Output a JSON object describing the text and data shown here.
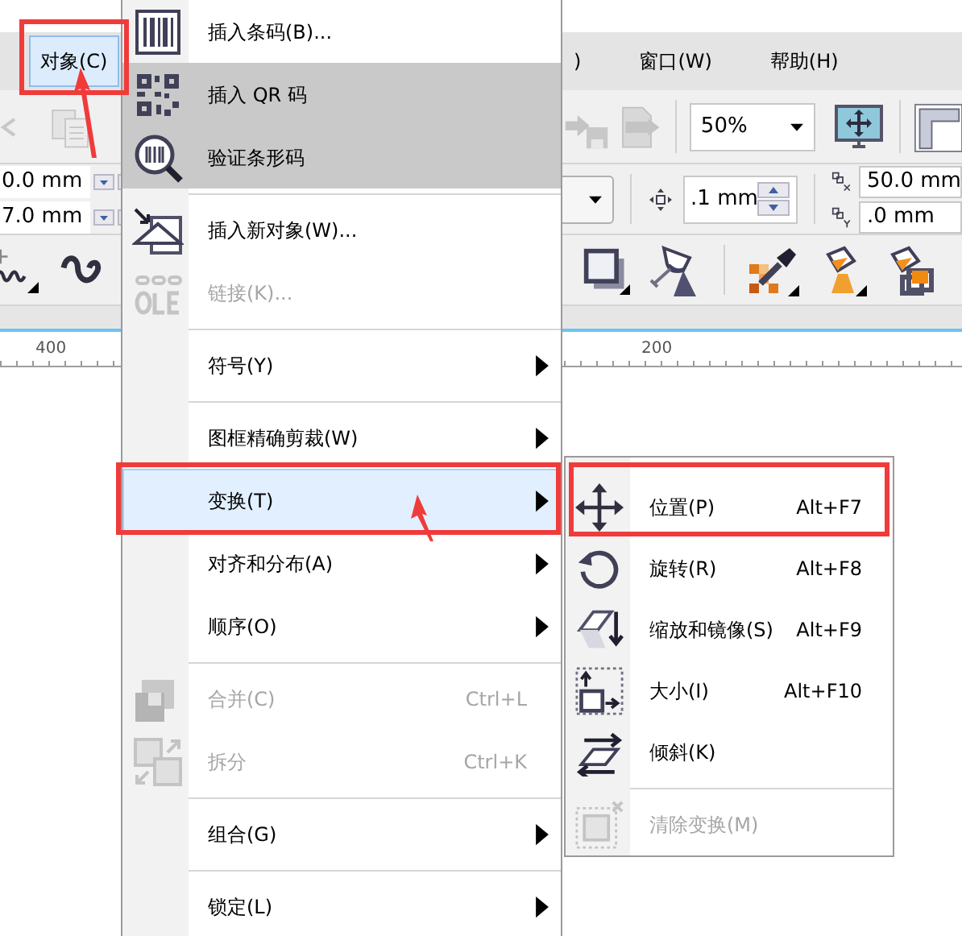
{
  "menubar": [
    {
      "label": "对象(C)",
      "selected": true,
      "framed": true,
      "arrow": true
    },
    {
      "label": ")",
      "selected": false
    },
    {
      "label": "窗口(W)",
      "selected": false
    },
    {
      "label": "帮助(H)",
      "selected": false
    }
  ],
  "toolbar": {
    "zoom": "50%"
  },
  "property_bar": {
    "size_fields": [
      "0.0 mm",
      "7.0 mm"
    ],
    "nudge": ".1 mm",
    "duplicate_x": "50.0 mm",
    "duplicate_y": ".0 mm"
  },
  "ruler": {
    "labels": [
      "400",
      "200"
    ]
  },
  "menu": {
    "items": [
      {
        "kind": "item",
        "label": "插入条码(B)...",
        "shaded": false,
        "disabled": false,
        "selected": false,
        "submenu": false
      },
      {
        "kind": "item",
        "label": "插入 QR 码",
        "shaded": true,
        "disabled": false,
        "selected": false,
        "submenu": false
      },
      {
        "kind": "item",
        "label": "验证条形码",
        "shaded": true,
        "disabled": false,
        "selected": false,
        "submenu": false
      },
      {
        "kind": "separator"
      },
      {
        "kind": "item",
        "label": "插入新对象(W)...",
        "shaded": false,
        "disabled": false,
        "selected": false,
        "submenu": false
      },
      {
        "kind": "item",
        "label": "链接(K)...",
        "shaded": false,
        "disabled": true,
        "selected": false,
        "submenu": false
      },
      {
        "kind": "separator"
      },
      {
        "kind": "item",
        "label": "符号(Y)",
        "shaded": false,
        "disabled": false,
        "selected": false,
        "submenu": true
      },
      {
        "kind": "separator"
      },
      {
        "kind": "item",
        "label": "图框精确剪裁(W)",
        "shaded": false,
        "disabled": false,
        "selected": false,
        "submenu": true
      },
      {
        "kind": "item",
        "label": "变换(T)",
        "shaded": false,
        "disabled": false,
        "selected": true,
        "submenu": true,
        "framed": true,
        "arrow": true
      },
      {
        "kind": "item",
        "label": "对齐和分布(A)",
        "shaded": false,
        "disabled": false,
        "selected": false,
        "submenu": true
      },
      {
        "kind": "item",
        "label": "顺序(O)",
        "shaded": false,
        "disabled": false,
        "selected": false,
        "submenu": true
      },
      {
        "kind": "separator"
      },
      {
        "kind": "item",
        "label": "合并(C)",
        "shortcut": "Ctrl+L",
        "shaded": false,
        "disabled": true,
        "selected": false,
        "submenu": false
      },
      {
        "kind": "item",
        "label": "拆分",
        "shortcut": "Ctrl+K",
        "shaded": false,
        "disabled": true,
        "selected": false,
        "submenu": false
      },
      {
        "kind": "separator"
      },
      {
        "kind": "item",
        "label": "组合(G)",
        "shaded": false,
        "disabled": false,
        "selected": false,
        "submenu": true
      },
      {
        "kind": "separator"
      },
      {
        "kind": "item",
        "label": "锁定(L)",
        "shaded": false,
        "disabled": false,
        "selected": false,
        "submenu": true
      }
    ]
  },
  "submenu": {
    "items": [
      {
        "kind": "item",
        "label": "位置(P)",
        "shortcut": "Alt+F7",
        "disabled": false,
        "framed": true
      },
      {
        "kind": "item",
        "label": "旋转(R)",
        "shortcut": "Alt+F8",
        "disabled": false
      },
      {
        "kind": "item",
        "label": "缩放和镜像(S)",
        "shortcut": "Alt+F9",
        "disabled": false
      },
      {
        "kind": "item",
        "label": "大小(I)",
        "shortcut": "Alt+F10",
        "disabled": false
      },
      {
        "kind": "item",
        "label": "倾斜(K)",
        "disabled": false
      },
      {
        "kind": "separator"
      },
      {
        "kind": "item",
        "label": "清除变换(M)",
        "disabled": true
      }
    ]
  }
}
